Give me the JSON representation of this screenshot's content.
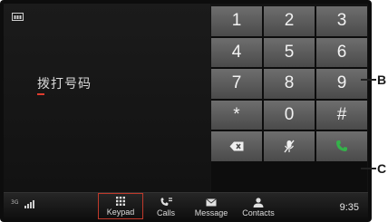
{
  "dial_area": {
    "text": "拨打号码"
  },
  "keypad": {
    "keys": [
      {
        "label": "1",
        "icon": null
      },
      {
        "label": "2",
        "icon": null
      },
      {
        "label": "3",
        "icon": null
      },
      {
        "label": "4",
        "icon": null
      },
      {
        "label": "5",
        "icon": null
      },
      {
        "label": "6",
        "icon": null
      },
      {
        "label": "7",
        "icon": null
      },
      {
        "label": "8",
        "icon": null
      },
      {
        "label": "9",
        "icon": null
      },
      {
        "label": "*",
        "icon": null
      },
      {
        "label": "0",
        "icon": null
      },
      {
        "label": "#",
        "icon": null
      },
      {
        "label": "",
        "icon": "backspace-icon"
      },
      {
        "label": "",
        "icon": "mute-icon"
      },
      {
        "label": "",
        "icon": "call-icon"
      }
    ]
  },
  "bottom_bar": {
    "network": "3G",
    "nav": [
      {
        "label": "Keypad",
        "icon": "keypad-icon",
        "active": true
      },
      {
        "label": "Calls",
        "icon": "calls-icon",
        "active": false
      },
      {
        "label": "Message",
        "icon": "message-icon",
        "active": false
      },
      {
        "label": "Contacts",
        "icon": "contacts-icon",
        "active": false
      }
    ],
    "time": "9:35"
  },
  "callouts": {
    "b": "B",
    "c": "C"
  },
  "colors": {
    "call_green": "#34b24a",
    "active_outline": "#c0392b",
    "cursor": "#e03c2e"
  }
}
